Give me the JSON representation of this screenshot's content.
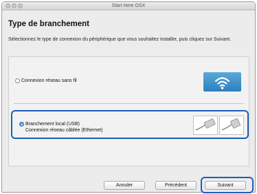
{
  "window": {
    "title": "Start Here OSX"
  },
  "page": {
    "heading": "Type de branchement",
    "description": "Sélectionnez le type de connexion du périphérique que vous souhaitez installer, puis cliquez sur Suivant."
  },
  "options": {
    "wireless": {
      "label": "Connexion réseau sans fil",
      "selected": false,
      "icon": "wifi-icon"
    },
    "usb": {
      "label": "Branchement local (USB)",
      "label2": "Connexion réseau câblée (Ethernet)",
      "selected": true,
      "icon": "usb-cable-icon"
    }
  },
  "buttons": {
    "cancel": "Annuler",
    "previous": "Précédent",
    "next": "Suivant"
  },
  "colors": {
    "highlight": "#1c5db8",
    "wifi_tile": "#3d8fcb"
  }
}
